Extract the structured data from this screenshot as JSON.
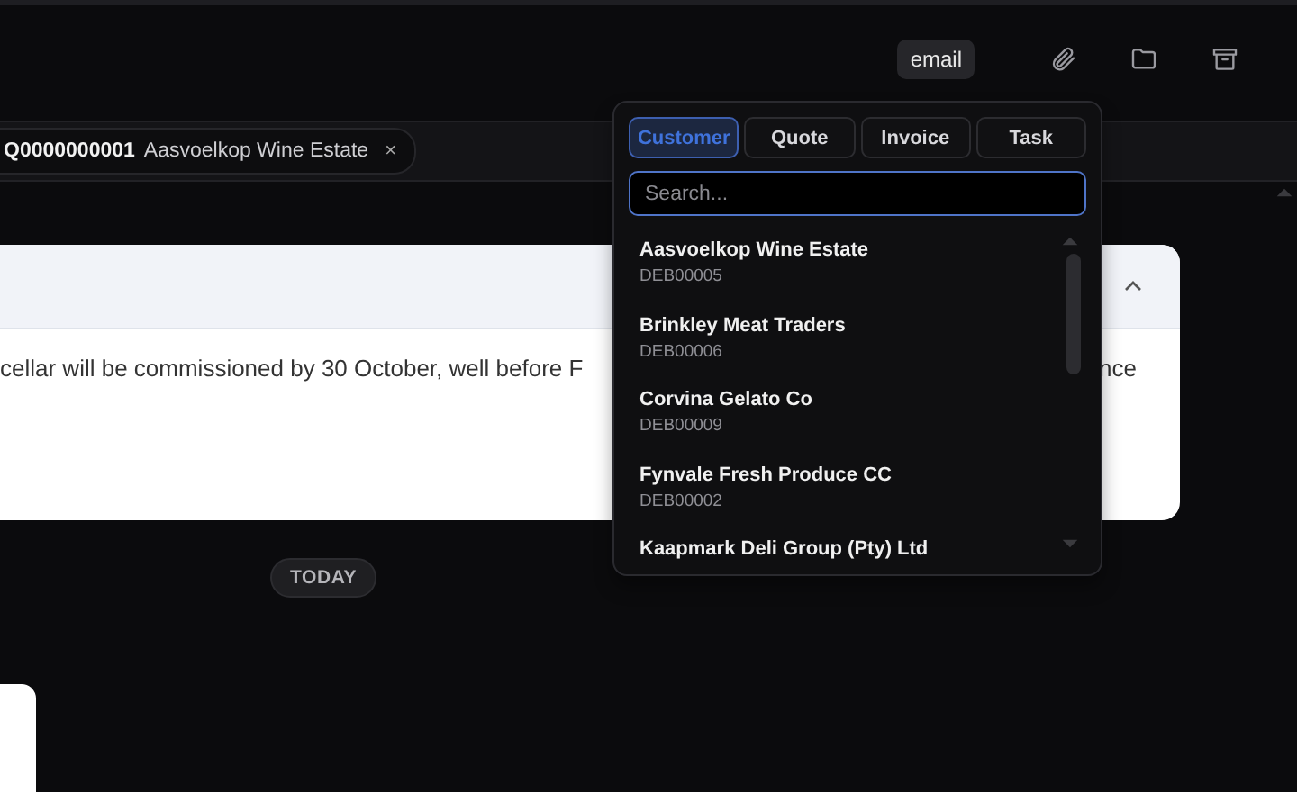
{
  "toolbar": {
    "badge": "email"
  },
  "open_tabs": [
    {
      "code": "Q0000000001",
      "name": "Aasvoelkop Wine Estate",
      "close": "×"
    }
  ],
  "card": {
    "text_left": "cellar will be commissioned by 30 October, well before F",
    "text_right": "nce",
    "expanded": true
  },
  "day_divider": "TODAY",
  "picker": {
    "tabs": [
      {
        "label": "Customer",
        "selected": true
      },
      {
        "label": "Quote",
        "selected": false
      },
      {
        "label": "Invoice",
        "selected": false
      },
      {
        "label": "Task",
        "selected": false
      }
    ],
    "search": {
      "placeholder": "Search..."
    },
    "results": [
      {
        "name": "Aasvoelkop Wine Estate",
        "code": "DEB00005"
      },
      {
        "name": "Brinkley Meat Traders",
        "code": "DEB00006"
      },
      {
        "name": "Corvina Gelato Co",
        "code": "DEB00009"
      },
      {
        "name": "Fynvale Fresh Produce CC",
        "code": "DEB00002"
      },
      {
        "name": "Kaapmark Deli Group (Pty) Ltd"
      }
    ]
  }
}
